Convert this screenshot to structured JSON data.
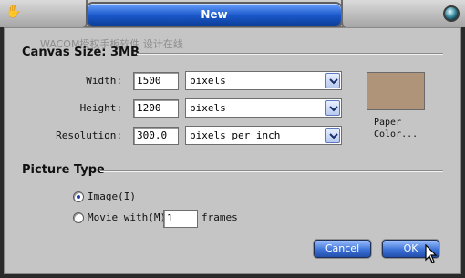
{
  "window": {
    "title": "New"
  },
  "watermark": "WACOM授权手板软件 设计在线",
  "canvas_size": {
    "heading": "Canvas Size: 3MB",
    "width_label": "Width:",
    "width_value": "1500",
    "width_unit": "pixels",
    "height_label": "Height:",
    "height_value": "1200",
    "height_unit": "pixels",
    "resolution_label": "Resolution:",
    "resolution_value": "300.0",
    "resolution_unit": "pixels per inch"
  },
  "paper": {
    "label_line1": "Paper",
    "label_line2": "Color...",
    "color": "#b09479"
  },
  "picture_type": {
    "heading": "Picture Type",
    "image_label": "Image(I)",
    "image_selected": true,
    "movie_label": "Movie with(M)",
    "movie_selected": false,
    "frames_value": "1",
    "frames_label": "frames"
  },
  "buttons": {
    "cancel": "Cancel",
    "ok": "OK"
  }
}
